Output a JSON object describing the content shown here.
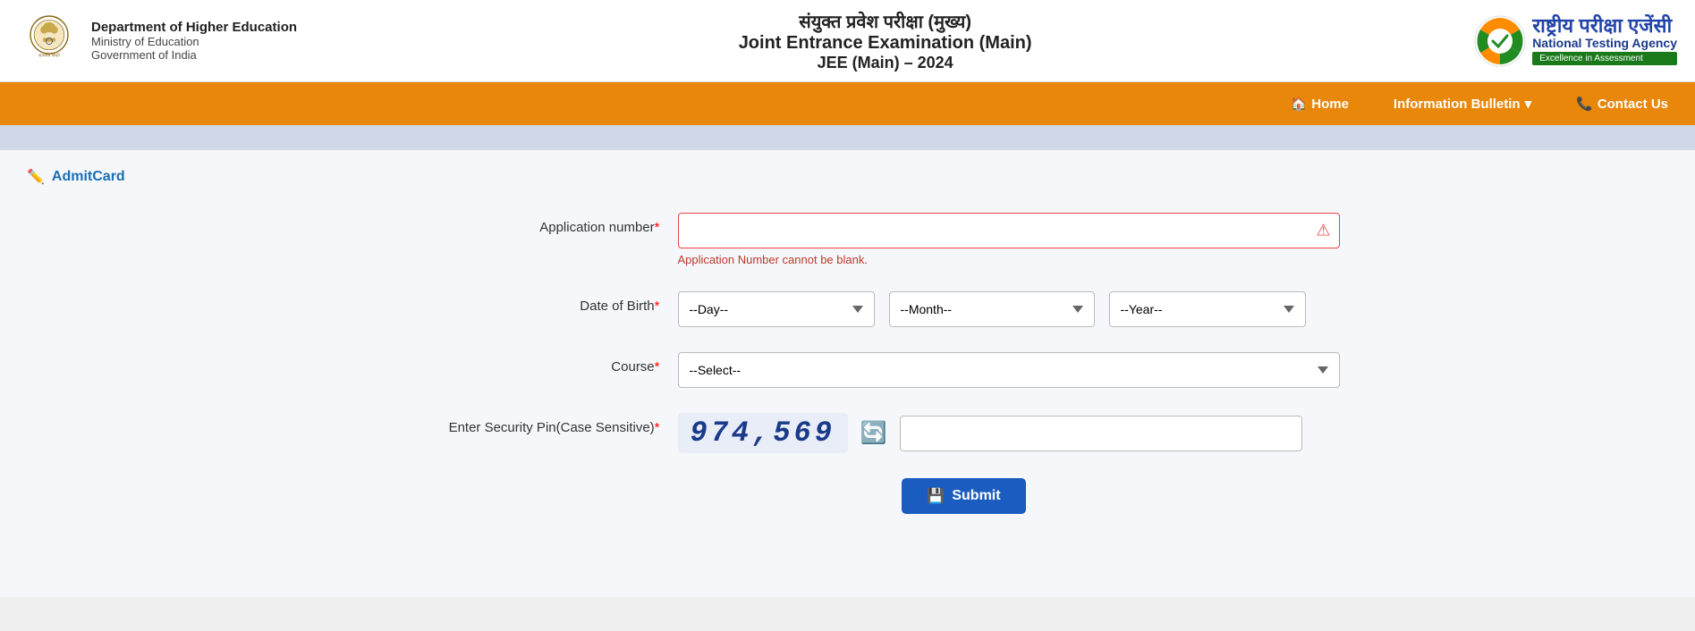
{
  "header": {
    "dept_name": "Department of Higher Education",
    "ministry": "Ministry of Education",
    "govt": "Government of India",
    "hindi_title": "संयुक्त प्रवेश परीक्षा (मुख्य)",
    "english_title": "Joint Entrance Examination (Main)",
    "year_title": "JEE (Main) – 2024",
    "nta_brand": "National Testing Agency",
    "nta_tagline": "Excellence in Assessment"
  },
  "navbar": {
    "home_label": "Home",
    "bulletin_label": "Information Bulletin",
    "contact_label": "Contact Us"
  },
  "page": {
    "breadcrumb_label": "AdmitCard",
    "form": {
      "app_number_label": "Application number",
      "app_number_required": "*",
      "app_number_error": "Application Number cannot be blank.",
      "dob_label": "Date of Birth",
      "dob_required": "*",
      "day_placeholder": "--Day--",
      "month_placeholder": "--Month--",
      "year_placeholder": "--Year--",
      "course_label": "Course",
      "course_required": "*",
      "course_placeholder": "--Select--",
      "security_label": "Enter Security Pin(Case Sensitive)",
      "security_required": "*",
      "captcha_value": "974,569",
      "submit_label": "Submit"
    }
  }
}
